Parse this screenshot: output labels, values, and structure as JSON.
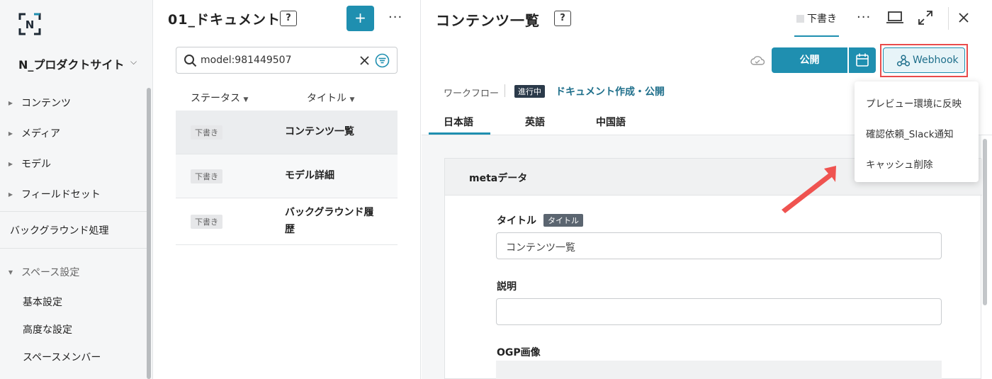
{
  "sidebar": {
    "site_name": "N_プロダクトサイト",
    "items": [
      {
        "label": "コンテンツ"
      },
      {
        "label": "メディア"
      },
      {
        "label": "モデル"
      },
      {
        "label": "フィールドセット"
      }
    ],
    "background_label": "バックグラウンド処理",
    "space_settings": {
      "label": "スペース設定",
      "children": [
        "基本設定",
        "高度な設定",
        "スペースメンバー"
      ]
    }
  },
  "list": {
    "title": "01_ドキュメント",
    "search_value": "model:981449507",
    "columns": [
      "ステータス",
      "タイトル"
    ],
    "rows": [
      {
        "status": "下書き",
        "title": "コンテンツ一覧"
      },
      {
        "status": "下書き",
        "title": "モデル詳細"
      },
      {
        "status": "下書き",
        "title_line1": "バックグラウンド履",
        "title_line2": "歴"
      }
    ]
  },
  "detail": {
    "title": "コンテンツ一覧",
    "status_tab": "下書き",
    "publish_label": "公開",
    "webhook_label": "Webhook",
    "workflow_label": "ワークフロー",
    "workflow_badge": "進行中",
    "workflow_name": "ドキュメント作成・公開",
    "lang_tabs": [
      "日本語",
      "英語",
      "中国語"
    ],
    "section_title": "metaデータ",
    "fields": {
      "title_label": "タイトル",
      "title_tag": "タイトル",
      "title_value": "コンテンツ一覧",
      "desc_label": "説明",
      "desc_value": "",
      "ogp_label": "OGP画像"
    }
  },
  "webhook_menu": [
    "プレビュー環境に反映",
    "確認依頼_Slack通知",
    "キャッシュ削除"
  ],
  "colors": {
    "accent": "#1f8fb0",
    "highlight": "#e94b4b"
  }
}
